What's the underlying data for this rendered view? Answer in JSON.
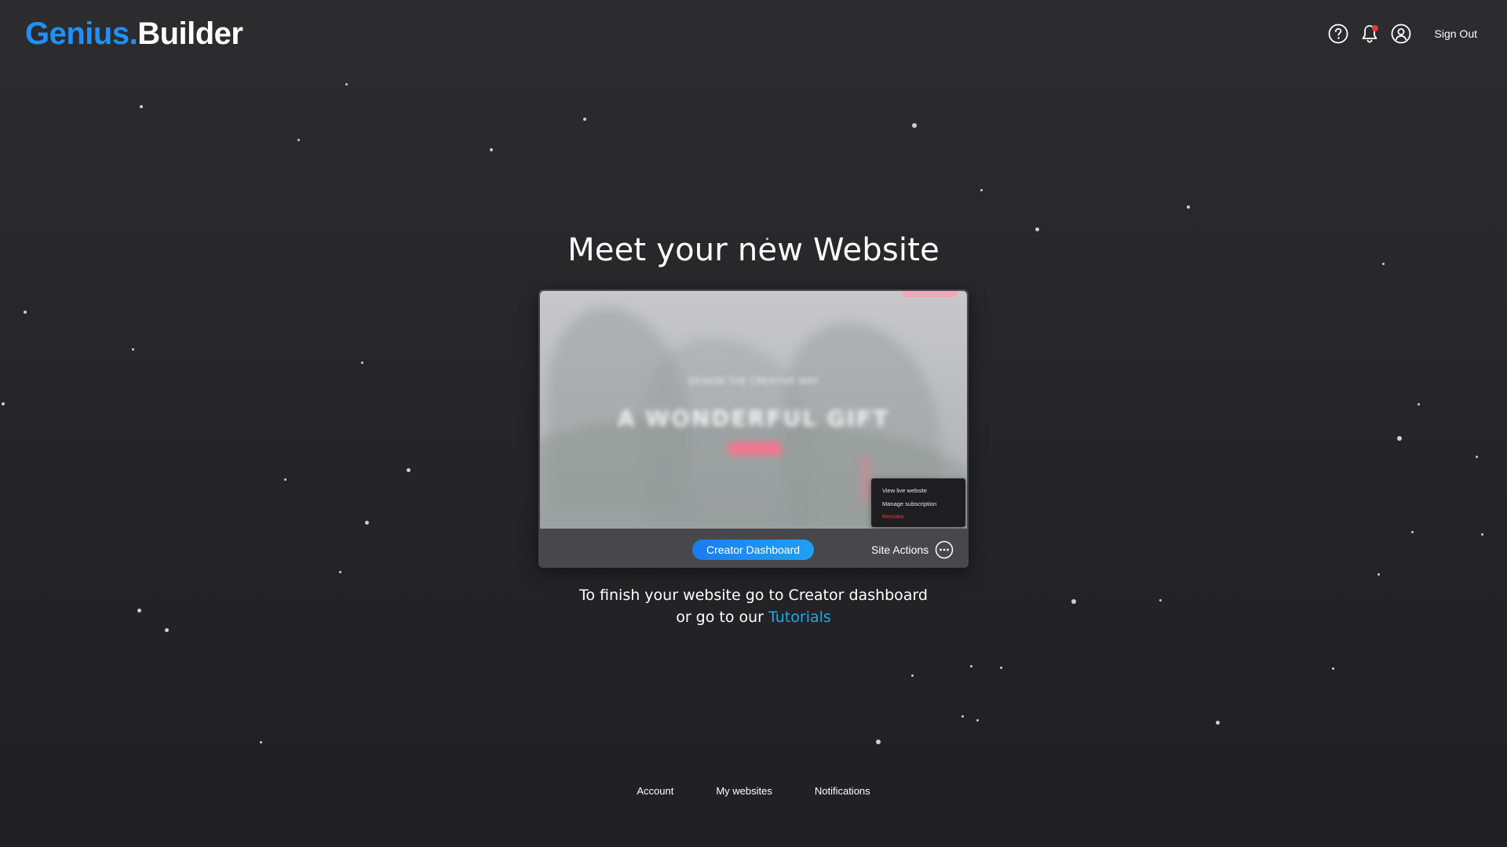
{
  "header": {
    "logo_part1": "Genius.",
    "logo_part2": "Builder",
    "icons": [
      "help-circle-icon",
      "bell-icon",
      "user-circle-icon"
    ],
    "sign_out_label": "Sign Out"
  },
  "main": {
    "headline": "Meet your new Website",
    "preview": {
      "subtitle_blurred": "DESIGN THE CREATIVE WAY",
      "title_blurred": "A WONDERFUL GIFT",
      "context_menu": [
        {
          "label": "View live website"
        },
        {
          "label": "Manage subscription"
        },
        {
          "label": "Remake"
        }
      ]
    },
    "creator_dashboard_label": "Creator Dashboard",
    "site_actions_label": "Site Actions",
    "finish_line1": "To finish your website go to Creator dashboard",
    "finish_line2_prefix": "or go to our ",
    "tutorials_label": "Tutorials"
  },
  "footer": {
    "links": [
      {
        "label": "Account"
      },
      {
        "label": "My websites"
      },
      {
        "label": "Notifications"
      }
    ]
  },
  "colors": {
    "brand_blue": "#1e90ff",
    "link_cyan": "#22a7e8",
    "danger_red": "#e53935",
    "background": "#2a2a2d"
  }
}
